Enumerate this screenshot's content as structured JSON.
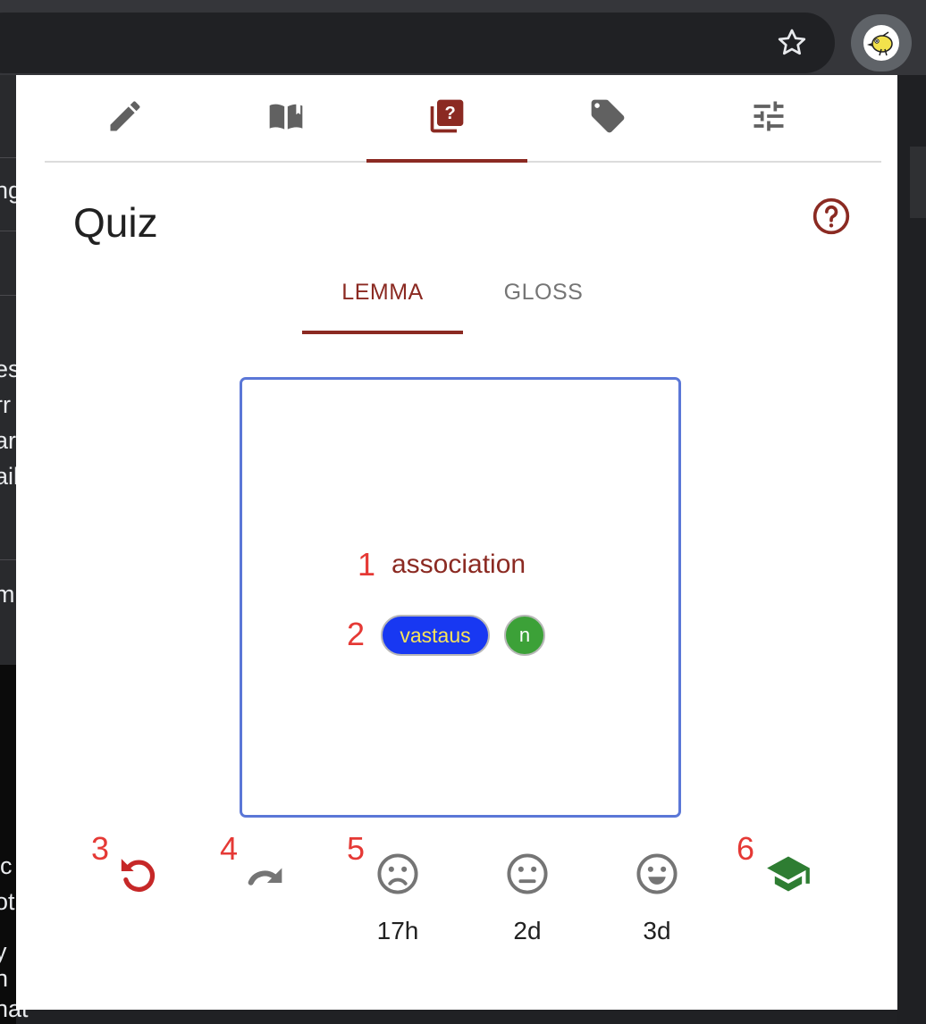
{
  "popup": {
    "title": "Quiz",
    "nav_tabs": [
      {
        "icon": "pencil-icon",
        "active": false
      },
      {
        "icon": "book-icon",
        "active": false
      },
      {
        "icon": "quiz-icon",
        "active": true
      },
      {
        "icon": "tag-icon",
        "active": false
      },
      {
        "icon": "sliders-icon",
        "active": false
      }
    ],
    "subtabs": [
      "LEMMA",
      "GLOSS"
    ],
    "active_subtab": "LEMMA",
    "card": {
      "lemma": "association",
      "gloss": "vastaus",
      "part_of_speech": "n"
    },
    "markers": [
      "1",
      "2",
      "3",
      "4",
      "5",
      "6"
    ],
    "actions": {
      "undo_icon": "undo-icon",
      "skip_icon": "redo-icon",
      "graduate_icon": "graduation-cap-icon"
    },
    "ratings": [
      {
        "icon": "sad-face-icon",
        "interval": "17h"
      },
      {
        "icon": "neutral-face-icon",
        "interval": "2d"
      },
      {
        "icon": "happy-face-icon",
        "interval": "3d"
      }
    ]
  },
  "background_page": {
    "text_fragments": [
      "ng",
      "es",
      "rr",
      "ar",
      "ail",
      "m",
      "ic",
      "ot",
      "y",
      "n",
      "hat"
    ]
  },
  "colors": {
    "accent": "#8b2a22",
    "marker": "#e53935",
    "card_border": "#5b77d7",
    "gloss_bg": "#1838f2",
    "gloss_text": "#f7e45a",
    "pos_bg": "#3ca138",
    "graduate": "#2e7d32",
    "undo": "#c62828"
  }
}
